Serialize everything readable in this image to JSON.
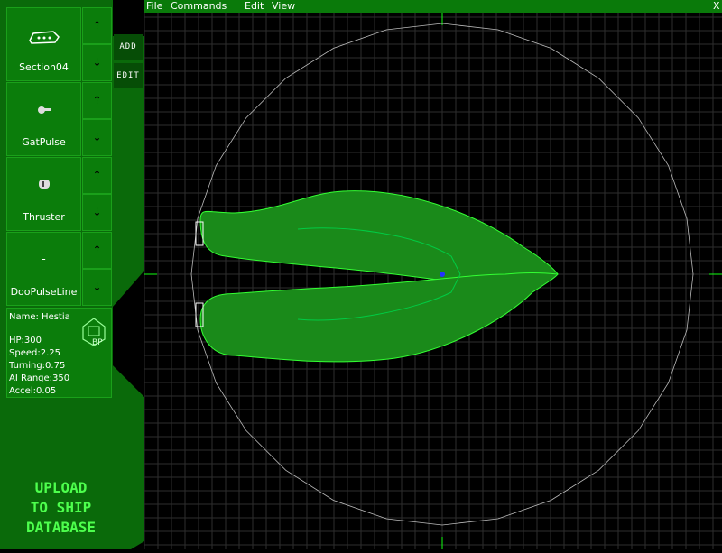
{
  "menu": {
    "file": "File",
    "commands": "Commands",
    "edit": "Edit",
    "view": "View",
    "close": "X"
  },
  "tabs": {
    "add": "ADD",
    "edit": "EDIT"
  },
  "parts": [
    {
      "name": "Section04",
      "icon": "ship-section-icon"
    },
    {
      "name": "GatPulse",
      "icon": "gun-icon"
    },
    {
      "name": "Thruster",
      "icon": "thruster-icon"
    },
    {
      "name": "DooPulseLine",
      "icon": "dot-icon",
      "icon_text": "-"
    }
  ],
  "ship": {
    "name": "Name: Hestia",
    "hp": "HP:300",
    "speed": "Speed:2.25",
    "turning": "Turning:0.75",
    "ai_range": "AI Range:350",
    "accel": "Accel:0.05",
    "badge": "BP"
  },
  "upload": {
    "line1": "UPLOAD",
    "line2": "TO SHIP",
    "line3": "DATABASE"
  },
  "colors": {
    "panel": "#0a6a0a",
    "grid": "#2e2e2e",
    "ship": "#1a8a1a",
    "upload_text": "#4dff4d"
  }
}
